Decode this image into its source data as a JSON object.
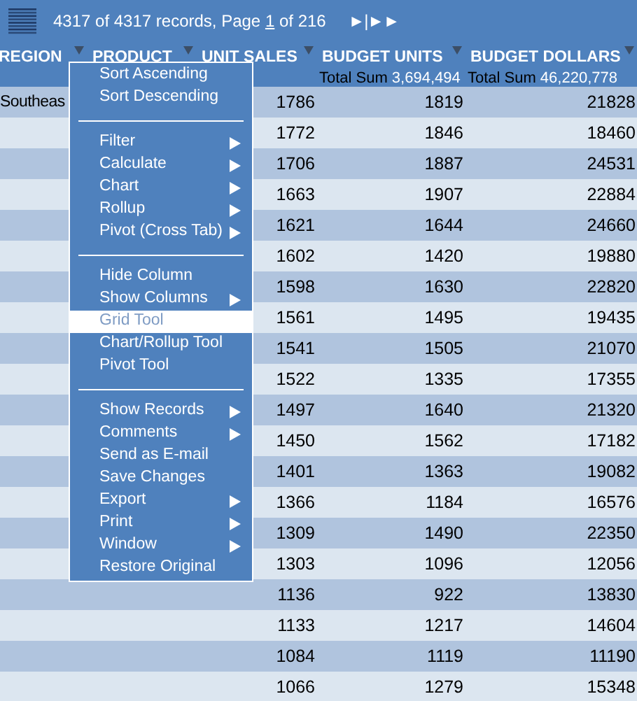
{
  "toolbar": {
    "summary_prefix": "4317 of 4317 records, Page ",
    "page_link": "1",
    "summary_suffix": " of 216",
    "nav": "►|►►"
  },
  "columns": [
    {
      "label": "REGION"
    },
    {
      "label": "PRODUCT"
    },
    {
      "label": "UNIT SALES"
    },
    {
      "label": "BUDGET UNITS",
      "total_label": "Total Sum",
      "total_value": "3,694,494"
    },
    {
      "label": "BUDGET DOLLARS",
      "total_label": "Total Sum",
      "total_value": "46,220,778"
    }
  ],
  "rows": [
    {
      "region": "Southeas",
      "unit_sales": "1786",
      "budget_units": "1819",
      "budget_dollars": "21828"
    },
    {
      "unit_sales": "1772",
      "budget_units": "1846",
      "budget_dollars": "18460"
    },
    {
      "unit_sales": "1706",
      "budget_units": "1887",
      "budget_dollars": "24531"
    },
    {
      "unit_sales": "1663",
      "budget_units": "1907",
      "budget_dollars": "22884"
    },
    {
      "unit_sales": "1621",
      "budget_units": "1644",
      "budget_dollars": "24660"
    },
    {
      "unit_sales": "1602",
      "budget_units": "1420",
      "budget_dollars": "19880"
    },
    {
      "unit_sales": "1598",
      "budget_units": "1630",
      "budget_dollars": "22820"
    },
    {
      "unit_sales": "1561",
      "budget_units": "1495",
      "budget_dollars": "19435"
    },
    {
      "unit_sales": "1541",
      "budget_units": "1505",
      "budget_dollars": "21070"
    },
    {
      "unit_sales": "1522",
      "budget_units": "1335",
      "budget_dollars": "17355"
    },
    {
      "unit_sales": "1497",
      "budget_units": "1640",
      "budget_dollars": "21320"
    },
    {
      "unit_sales": "1450",
      "budget_units": "1562",
      "budget_dollars": "17182"
    },
    {
      "unit_sales": "1401",
      "budget_units": "1363",
      "budget_dollars": "19082"
    },
    {
      "unit_sales": "1366",
      "budget_units": "1184",
      "budget_dollars": "16576"
    },
    {
      "unit_sales": "1309",
      "budget_units": "1490",
      "budget_dollars": "22350"
    },
    {
      "unit_sales": "1303",
      "budget_units": "1096",
      "budget_dollars": "12056"
    },
    {
      "unit_sales": "1136",
      "budget_units": "922",
      "budget_dollars": "13830"
    },
    {
      "unit_sales": "1133",
      "budget_units": "1217",
      "budget_dollars": "14604"
    },
    {
      "unit_sales": "1084",
      "budget_units": "1119",
      "budget_dollars": "11190"
    },
    {
      "unit_sales": "1066",
      "budget_units": "1279",
      "budget_dollars": "15348"
    }
  ],
  "context_menu": [
    {
      "kind": "item",
      "label": "Sort Ascending",
      "submenu": false,
      "selected": false
    },
    {
      "kind": "item",
      "label": "Sort Descending",
      "submenu": false,
      "selected": false
    },
    {
      "kind": "separator"
    },
    {
      "kind": "item",
      "label": "Filter",
      "submenu": true,
      "selected": false
    },
    {
      "kind": "item",
      "label": "Calculate",
      "submenu": true,
      "selected": false
    },
    {
      "kind": "item",
      "label": "Chart",
      "submenu": true,
      "selected": false
    },
    {
      "kind": "item",
      "label": "Rollup",
      "submenu": true,
      "selected": false
    },
    {
      "kind": "item",
      "label": "Pivot (Cross Tab)",
      "submenu": true,
      "selected": false
    },
    {
      "kind": "separator"
    },
    {
      "kind": "item",
      "label": "Hide Column",
      "submenu": false,
      "selected": false
    },
    {
      "kind": "item",
      "label": "Show Columns",
      "submenu": true,
      "selected": false
    },
    {
      "kind": "item",
      "label": "Grid Tool",
      "submenu": false,
      "selected": true
    },
    {
      "kind": "item",
      "label": "Chart/Rollup Tool",
      "submenu": false,
      "selected": false
    },
    {
      "kind": "item",
      "label": "Pivot Tool",
      "submenu": false,
      "selected": false
    },
    {
      "kind": "separator"
    },
    {
      "kind": "item",
      "label": "Show Records",
      "submenu": true,
      "selected": false
    },
    {
      "kind": "item",
      "label": "Comments",
      "submenu": true,
      "selected": false
    },
    {
      "kind": "item",
      "label": "Send as E-mail",
      "submenu": false,
      "selected": false
    },
    {
      "kind": "item",
      "label": "Save Changes",
      "submenu": false,
      "selected": false
    },
    {
      "kind": "item",
      "label": "Export",
      "submenu": true,
      "selected": false
    },
    {
      "kind": "item",
      "label": "Print",
      "submenu": true,
      "selected": false
    },
    {
      "kind": "item",
      "label": "Window",
      "submenu": true,
      "selected": false
    },
    {
      "kind": "item",
      "label": "Restore Original",
      "submenu": false,
      "selected": false
    }
  ]
}
